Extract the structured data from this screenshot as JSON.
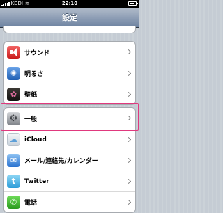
{
  "status_bar": {
    "carrier": "KDDI",
    "time": "22:10"
  },
  "nav": {
    "title": "設定"
  },
  "group1": [
    {
      "label": "サウンド",
      "icon": "speaker-icon"
    },
    {
      "label": "明るさ",
      "icon": "brightness-icon"
    },
    {
      "label": "壁紙",
      "icon": "wallpaper-icon"
    }
  ],
  "group2": [
    {
      "label": "一般",
      "icon": "gear-icon"
    },
    {
      "label": "iCloud",
      "icon": "cloud-icon"
    },
    {
      "label": "メール/連絡先/カレンダー",
      "icon": "mail-icon"
    },
    {
      "label": "Twitter",
      "icon": "twitter-icon"
    },
    {
      "label": "電話",
      "icon": "phone-icon"
    }
  ],
  "colors": {
    "highlight": "#e0397e",
    "navbar": "#6d83a1"
  }
}
